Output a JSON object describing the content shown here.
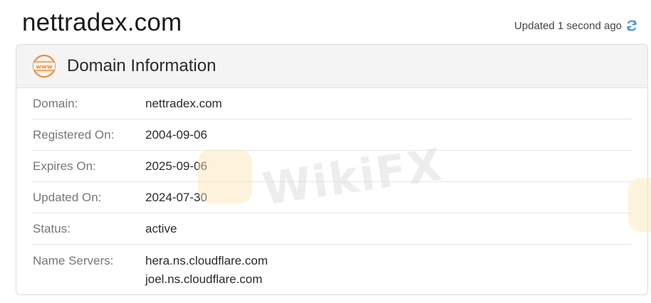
{
  "header": {
    "domain_title": "nettradex.com",
    "updated_text": "Updated 1 second ago",
    "refresh_icon": "refresh-icon"
  },
  "card": {
    "title": "Domain Information",
    "icon": "www-icon",
    "icon_text": "www",
    "rows": [
      {
        "label": "Domain:",
        "value": "nettradex.com"
      },
      {
        "label": "Registered On:",
        "value": "2004-09-06"
      },
      {
        "label": "Expires On:",
        "value": "2025-09-06"
      },
      {
        "label": "Updated On:",
        "value": "2024-07-30"
      },
      {
        "label": "Status:",
        "value": "active"
      }
    ],
    "name_servers": {
      "label": "Name Servers:",
      "values": [
        "hera.ns.cloudflare.com",
        "joel.ns.cloudflare.com"
      ]
    }
  },
  "watermark": {
    "text": "WikiFX"
  },
  "colors": {
    "accent_icon": "#f08a3c",
    "refresh": "#3a8ee6",
    "watermark_logo": "#fbe6b5"
  }
}
